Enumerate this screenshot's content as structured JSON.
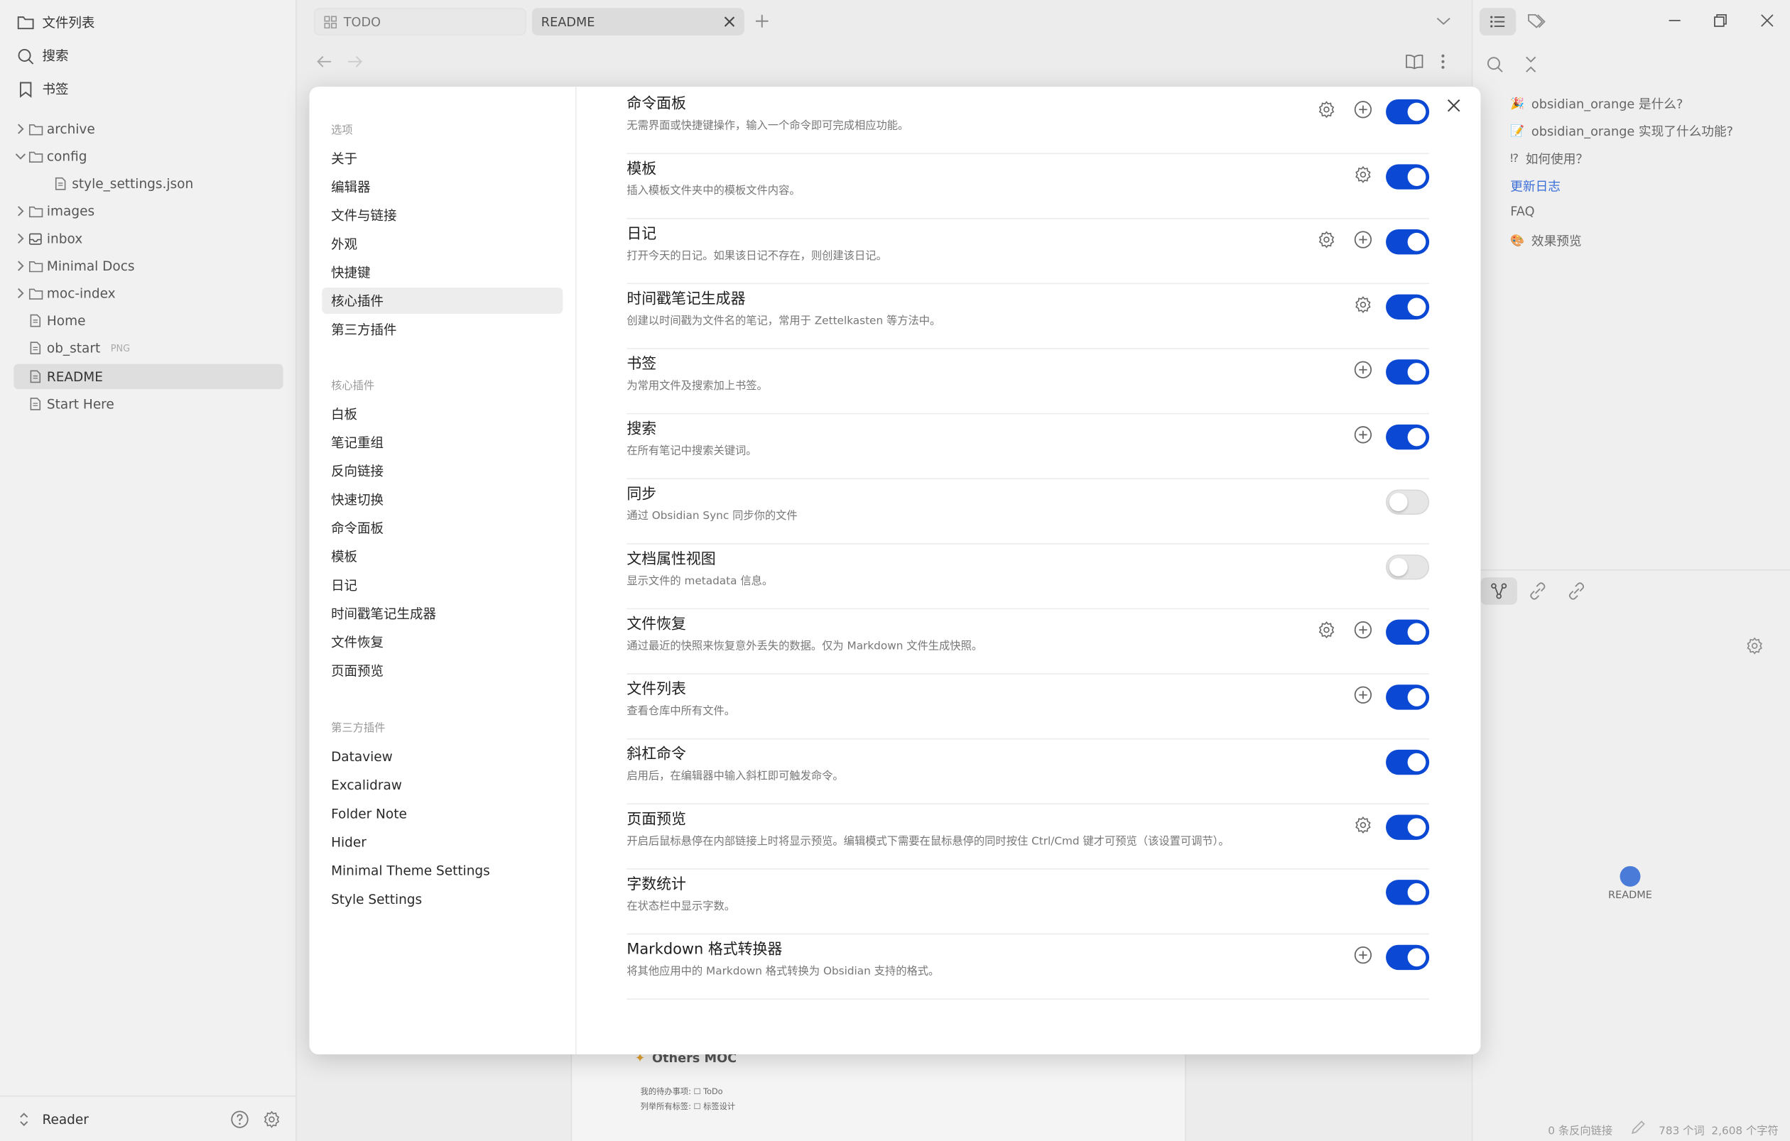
{
  "left_sidebar": {
    "file_list_label": "文件列表",
    "search_label": "搜索",
    "bookmarks_label": "书签",
    "tree": [
      {
        "label": "archive",
        "kind": "folder",
        "expanded": false
      },
      {
        "label": "config",
        "kind": "folder",
        "expanded": true
      },
      {
        "label": "style_settings.json",
        "kind": "file",
        "child": true
      },
      {
        "label": "images",
        "kind": "folder",
        "expanded": false
      },
      {
        "label": "inbox",
        "kind": "inbox",
        "expanded": false
      },
      {
        "label": "Minimal Docs",
        "kind": "folder",
        "expanded": false
      },
      {
        "label": "moc-index",
        "kind": "folder",
        "expanded": false
      },
      {
        "label": "Home",
        "kind": "file"
      },
      {
        "label": "ob_start",
        "kind": "file",
        "tag": "PNG"
      },
      {
        "label": "README",
        "kind": "file",
        "active": true
      },
      {
        "label": "Start Here",
        "kind": "file"
      }
    ],
    "vault_name": "Reader"
  },
  "tabs": [
    {
      "label": "TODO",
      "active": false
    },
    {
      "label": "README",
      "active": true
    }
  ],
  "right_sidebar": {
    "outline": [
      {
        "icon": "🎉",
        "label": "obsidian_orange 是什么?"
      },
      {
        "icon": "📝",
        "label": "obsidian_orange 实现了什么功能?"
      },
      {
        "icon": "⁉",
        "label": "如何使用？"
      },
      {
        "icon": "",
        "label": "更新日志",
        "link": true
      },
      {
        "icon": "",
        "label": "FAQ"
      },
      {
        "icon": "🎨",
        "label": "效果预览"
      }
    ],
    "graph_node_label": "README"
  },
  "status_bar": {
    "backlinks": "0 条反向链接",
    "counts": "783 个词  2,608 个字符"
  },
  "background_doc": {
    "heading": "Others MOC",
    "line1": "我的待办事项: ☐ ToDo",
    "line2": "列举所有标签: ☐ 标签设计"
  },
  "settings": {
    "nav_sections": [
      {
        "heading": "选项",
        "items": [
          "关于",
          "编辑器",
          "文件与链接",
          "外观",
          "快捷键",
          "核心插件",
          "第三方插件"
        ],
        "active": "核心插件"
      },
      {
        "heading": "核心插件",
        "items": [
          "白板",
          "笔记重组",
          "反向链接",
          "快速切换",
          "命令面板",
          "模板",
          "日记",
          "时间戳笔记生成器",
          "文件恢复",
          "页面预览"
        ]
      },
      {
        "heading": "第三方插件",
        "items": [
          "Dataview",
          "Excalidraw",
          "Folder Note",
          "Hider",
          "Minimal Theme Settings",
          "Style Settings"
        ]
      }
    ],
    "plugins": [
      {
        "name": "命令面板",
        "desc": "无需界面或快捷键操作，输入一个命令即可完成相应功能。",
        "settings": true,
        "hotkey": true,
        "enabled": true
      },
      {
        "name": "模板",
        "desc": "插入模板文件夹中的模板文件内容。",
        "settings": true,
        "hotkey": false,
        "enabled": true
      },
      {
        "name": "日记",
        "desc": "打开今天的日记。如果该日记不存在，则创建该日记。",
        "settings": true,
        "hotkey": true,
        "enabled": true
      },
      {
        "name": "时间戳笔记生成器",
        "desc": "创建以时间戳为文件名的笔记，常用于 Zettelkasten 等方法中。",
        "settings": true,
        "hotkey": false,
        "enabled": true
      },
      {
        "name": "书签",
        "desc": "为常用文件及搜索加上书签。",
        "settings": false,
        "hotkey": true,
        "enabled": true
      },
      {
        "name": "搜索",
        "desc": "在所有笔记中搜索关键词。",
        "settings": false,
        "hotkey": true,
        "enabled": true
      },
      {
        "name": "同步",
        "desc": "通过 Obsidian Sync 同步你的文件",
        "settings": false,
        "hotkey": false,
        "enabled": false
      },
      {
        "name": "文档属性视图",
        "desc": "显示文件的 metadata 信息。",
        "settings": false,
        "hotkey": false,
        "enabled": false
      },
      {
        "name": "文件恢复",
        "desc": "通过最近的快照来恢复意外丢失的数据。仅为 Markdown 文件生成快照。",
        "settings": true,
        "hotkey": true,
        "enabled": true
      },
      {
        "name": "文件列表",
        "desc": "查看仓库中所有文件。",
        "settings": false,
        "hotkey": true,
        "enabled": true
      },
      {
        "name": "斜杠命令",
        "desc": "启用后，在编辑器中输入斜杠即可触发命令。",
        "settings": false,
        "hotkey": false,
        "enabled": true
      },
      {
        "name": "页面预览",
        "desc": "开启后鼠标悬停在内部链接上时将显示预览。编辑模式下需要在鼠标悬停的同时按住 Ctrl/Cmd 键才可预览（该设置可调节）。",
        "settings": true,
        "hotkey": false,
        "enabled": true
      },
      {
        "name": "字数统计",
        "desc": "在状态栏中显示字数。",
        "settings": false,
        "hotkey": false,
        "enabled": true
      },
      {
        "name": "Markdown 格式转换器",
        "desc": "将其他应用中的 Markdown 格式转换为 Obsidian 支持的格式。",
        "settings": false,
        "hotkey": true,
        "enabled": true
      }
    ]
  },
  "colors": {
    "accent": "#0b48d3",
    "link": "#3b6fd8",
    "graph_node": "#4a7bd9"
  }
}
